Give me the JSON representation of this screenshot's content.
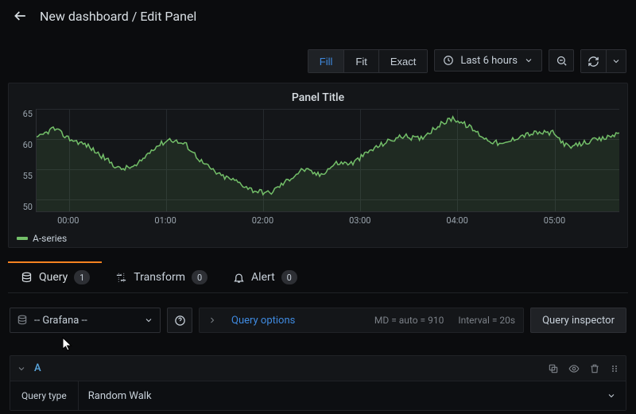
{
  "header": {
    "title": "New dashboard / Edit Panel"
  },
  "toolbar": {
    "seg": {
      "fill": "Fill",
      "fit": "Fit",
      "exact": "Exact"
    },
    "timerange": "Last 6 hours"
  },
  "panel": {
    "title": "Panel Title"
  },
  "legend": {
    "series_a": "A-series"
  },
  "tabs": {
    "query": {
      "label": "Query",
      "count": "1"
    },
    "transform": {
      "label": "Transform",
      "count": "0"
    },
    "alert": {
      "label": "Alert",
      "count": "0"
    }
  },
  "datasource": {
    "selected": "-- Grafana --"
  },
  "query_options": {
    "label": "Query options",
    "md": "MD = auto = 910",
    "interval": "Interval = 20s",
    "inspector": "Query inspector"
  },
  "query_a": {
    "id": "A",
    "type_label": "Query type",
    "type_value": "Random Walk"
  },
  "chart_data": {
    "type": "line",
    "title": "Panel Title",
    "xlabel": "",
    "ylabel": "",
    "ylim": [
      48,
      65
    ],
    "x_ticks": [
      "00:00",
      "01:00",
      "02:00",
      "03:00",
      "04:00",
      "05:00"
    ],
    "y_ticks": [
      50,
      55,
      60,
      65
    ],
    "series": [
      {
        "name": "A-series",
        "color": "#73bf69",
        "x": [
          "23:40",
          "00:00",
          "00:10",
          "00:20",
          "00:30",
          "00:40",
          "00:50",
          "01:00",
          "01:10",
          "01:20",
          "01:30",
          "01:40",
          "01:50",
          "02:00",
          "02:10",
          "02:20",
          "02:30",
          "02:40",
          "02:50",
          "03:00",
          "03:10",
          "03:20",
          "03:30",
          "03:40",
          "03:50",
          "04:00",
          "04:10",
          "04:20",
          "04:30",
          "04:40",
          "04:50",
          "05:00",
          "05:10",
          "05:20",
          "05:30",
          "05:40"
        ],
        "values": [
          60.0,
          61.8,
          60.0,
          59.0,
          57.0,
          55.0,
          55.5,
          58.5,
          60.0,
          59.0,
          56.0,
          54.0,
          53.0,
          51.5,
          51.0,
          53.0,
          55.0,
          54.0,
          56.0,
          56.0,
          58.0,
          59.5,
          60.5,
          60.0,
          62.0,
          63.5,
          62.0,
          60.0,
          59.0,
          60.5,
          61.0,
          61.0,
          58.5,
          59.5,
          60.0,
          61.0
        ]
      }
    ]
  }
}
